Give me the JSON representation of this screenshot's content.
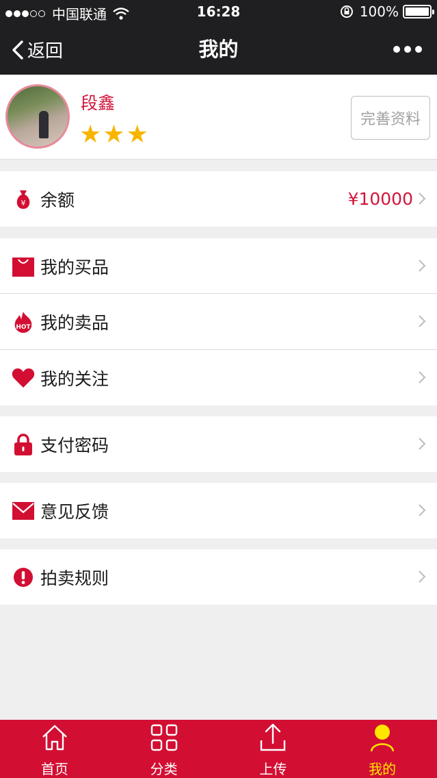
{
  "status_bar": {
    "carrier": "中国联通",
    "time": "16:28",
    "battery": "100%"
  },
  "nav": {
    "back_label": "返回",
    "title": "我的"
  },
  "profile": {
    "name": "段鑫",
    "star_count": 3,
    "edit_label": "完善资料"
  },
  "menu": {
    "balance": {
      "label": "余额",
      "value": "¥10000",
      "icon": "money-bag-icon"
    },
    "purchases": {
      "label": "我的买品",
      "icon": "shopping-bag-icon"
    },
    "sales": {
      "label": "我的卖品",
      "icon": "hot-flame-icon"
    },
    "follows": {
      "label": "我的关注",
      "icon": "heart-icon"
    },
    "pay_password": {
      "label": "支付密码",
      "icon": "lock-icon"
    },
    "feedback": {
      "label": "意见反馈",
      "icon": "mail-icon"
    },
    "rules": {
      "label": "拍卖规则",
      "icon": "exclamation-icon"
    }
  },
  "tabbar": {
    "home": "首页",
    "category": "分类",
    "upload": "上传",
    "mine": "我的",
    "active": "mine"
  },
  "colors": {
    "accent": "#d20f33",
    "active_tab": "#ffe600",
    "star": "#f7b500"
  }
}
